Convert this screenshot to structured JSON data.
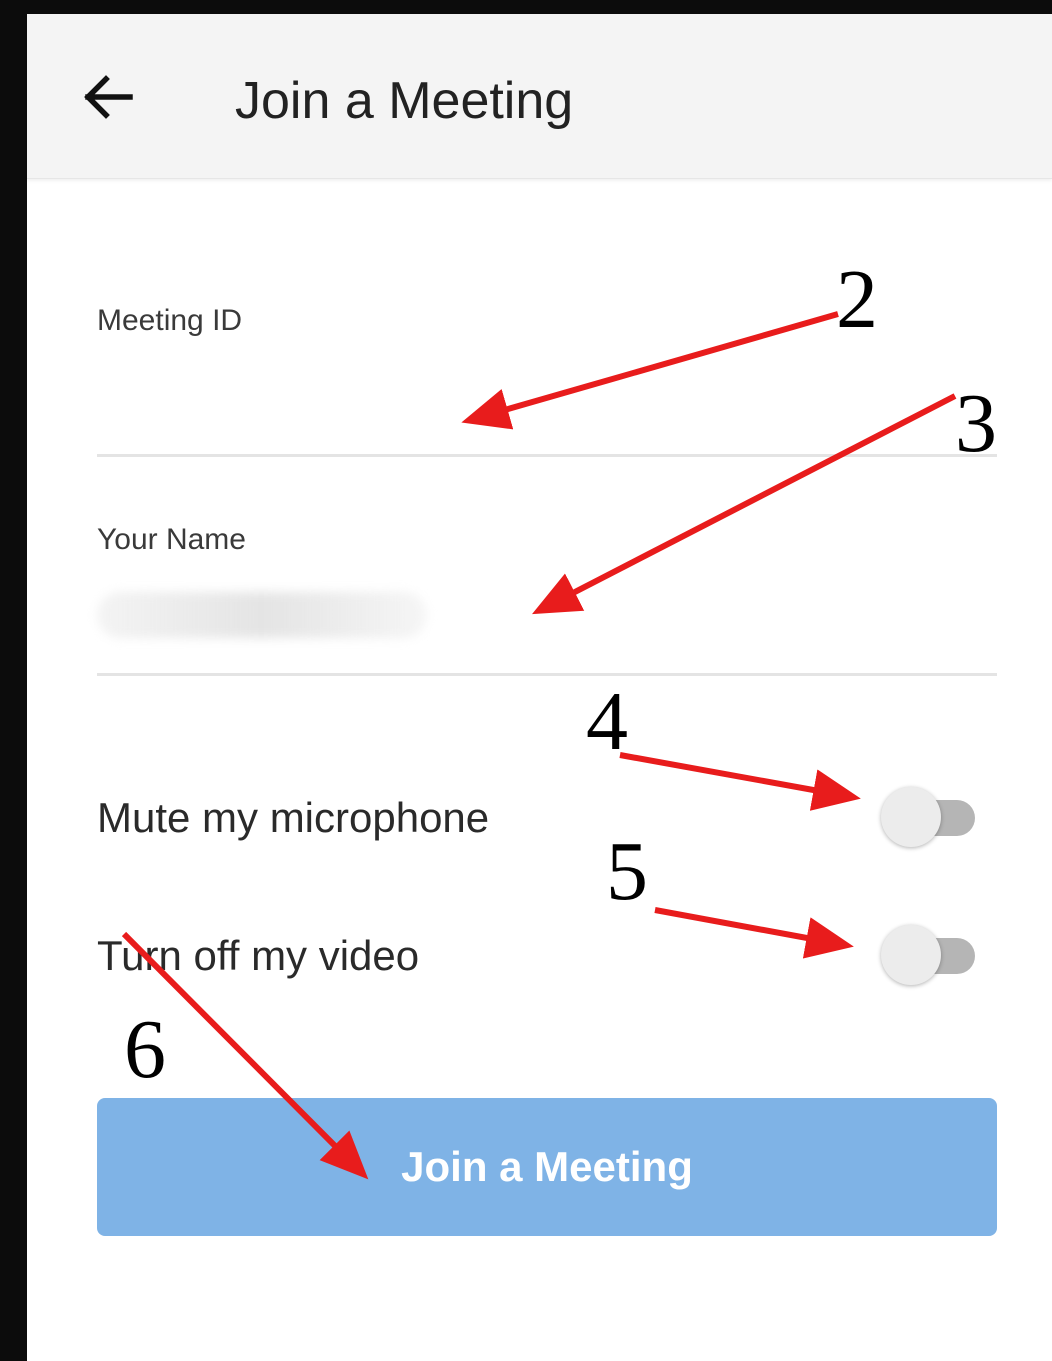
{
  "app_bar": {
    "back_icon": "arrow-left-icon",
    "title": "Join a Meeting"
  },
  "form": {
    "meeting_id": {
      "label": "Meeting ID",
      "value": "",
      "placeholder": ""
    },
    "your_name": {
      "label": "Your Name",
      "value_state": "blurred"
    }
  },
  "options": {
    "mute_microphone": {
      "label": "Mute my microphone",
      "on": false
    },
    "turn_off_video": {
      "label": "Turn off my video",
      "on": false
    }
  },
  "join_button": {
    "label": "Join a Meeting",
    "enabled": false
  },
  "annotations": {
    "arrow_color": "#e81c1c",
    "labels": [
      "2",
      "3",
      "4",
      "5",
      "6"
    ]
  },
  "colors": {
    "app_bar_bg": "#f4f4f4",
    "button_bg": "#7fb3e6",
    "toggle_track": "#b5b5b5",
    "toggle_thumb": "#ececec"
  }
}
